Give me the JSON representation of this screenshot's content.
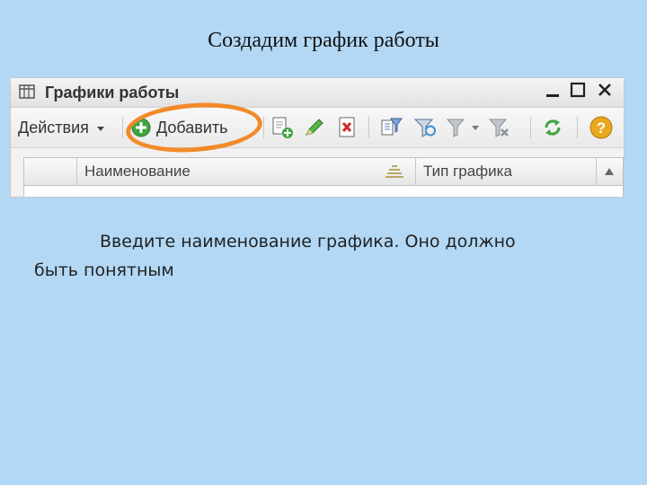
{
  "slide": {
    "title": "Создадим график работы",
    "instruction_line1": "Введите наименование графика. Оно должно",
    "instruction_line2": "быть понятным"
  },
  "window": {
    "title": "Графики работы",
    "controls": [
      "minimize",
      "maximize",
      "close"
    ]
  },
  "toolbar": {
    "actions_label": "Действия",
    "add_label": "Добавить",
    "icons": [
      "add-icon",
      "copy-icon",
      "edit-icon",
      "delete-icon",
      "set-filter-icon",
      "filter-icon",
      "filter-menu-icon",
      "clear-filter-icon",
      "refresh-icon",
      "help-icon"
    ]
  },
  "grid": {
    "columns": [
      "Наименование",
      "Тип графика"
    ]
  },
  "colors": {
    "slide_background": "#b3d8f5",
    "highlight": "#f28a2a",
    "add_icon": "#3fa43f",
    "delete_icon": "#d42a2a",
    "help_icon": "#e9a81f"
  }
}
